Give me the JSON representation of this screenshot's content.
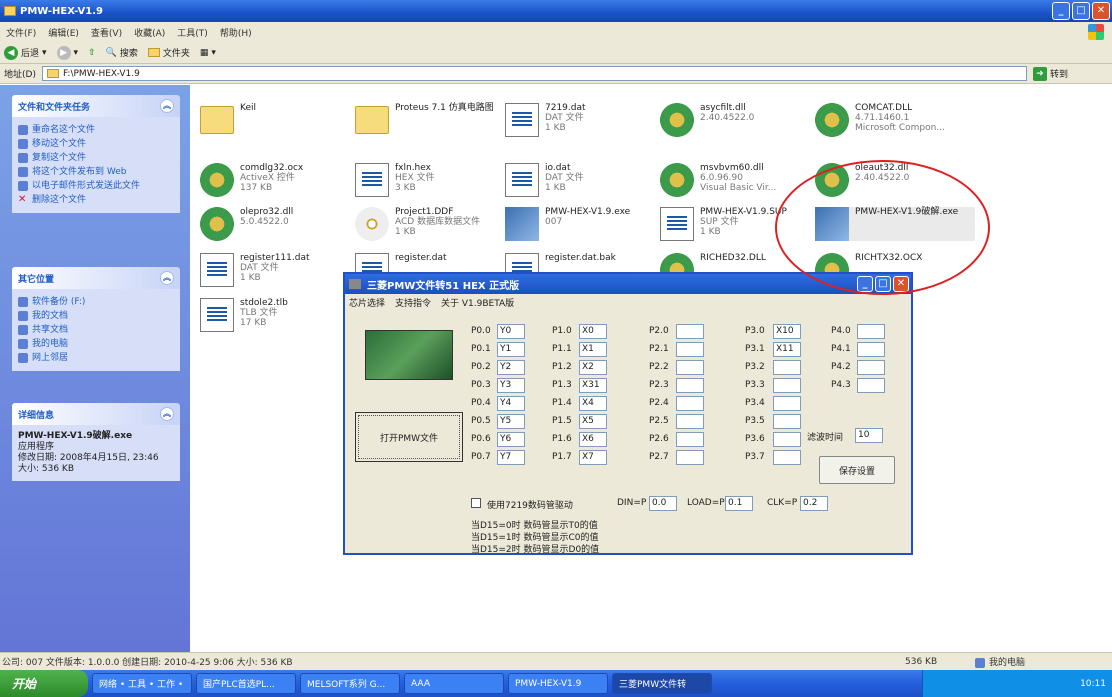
{
  "window": {
    "title": "PMW-HEX-V1.9"
  },
  "menubar": [
    "文件(F)",
    "编辑(E)",
    "查看(V)",
    "收藏(A)",
    "工具(T)",
    "帮助(H)"
  ],
  "toolbar": {
    "back": "后退",
    "search": "搜索",
    "folders": "文件夹"
  },
  "address": {
    "label": "地址(D)",
    "value": "F:\\PMW-HEX-V1.9",
    "go": "转到"
  },
  "tasks": {
    "header": "文件和文件夹任务",
    "items": [
      "重命名这个文件",
      "移动这个文件",
      "复制这个文件",
      "将这个文件发布到 Web",
      "以电子邮件形式发送此文件",
      "删除这个文件"
    ]
  },
  "places": {
    "header": "其它位置",
    "items": [
      "软件备份 (F:)",
      "我的文档",
      "共享文档",
      "我的电脑",
      "网上邻居"
    ]
  },
  "details": {
    "header": "详细信息",
    "name": "PMW-HEX-V1.9破解.exe",
    "type": "应用程序",
    "modified": "修改日期: 2008年4月15日, 23:46",
    "size": "大小: 536 KB"
  },
  "files": [
    {
      "name": "Keil",
      "sub1": "",
      "sub2": "",
      "icon": "folder-icon"
    },
    {
      "name": "Proteus 7.1 仿真电路图",
      "sub1": "",
      "sub2": "",
      "icon": "folder-icon"
    },
    {
      "name": "7219.dat",
      "sub1": "DAT 文件",
      "sub2": "1 KB",
      "icon": "doc-icon"
    },
    {
      "name": "asycfilt.dll",
      "sub1": "2.40.4522.0",
      "sub2": "",
      "icon": "gear-icon"
    },
    {
      "name": "COMCAT.DLL",
      "sub1": "4.71.1460.1",
      "sub2": "Microsoft Compon...",
      "icon": "gear-icon"
    },
    {
      "name": "comdlg32.ocx",
      "sub1": "ActiveX 控件",
      "sub2": "137 KB",
      "icon": "gear-icon"
    },
    {
      "name": "fxln.hex",
      "sub1": "HEX 文件",
      "sub2": "3 KB",
      "icon": "doc-icon"
    },
    {
      "name": "io.dat",
      "sub1": "DAT 文件",
      "sub2": "1 KB",
      "icon": "doc-icon"
    },
    {
      "name": "msvbvm60.dll",
      "sub1": "6.0.96.90",
      "sub2": "Visual Basic Vir...",
      "icon": "gear-icon"
    },
    {
      "name": "oleaut32.dll",
      "sub1": "2.40.4522.0",
      "sub2": "",
      "icon": "gear-icon"
    },
    {
      "name": "olepro32.dll",
      "sub1": "5.0.4522.0",
      "sub2": "",
      "icon": "gear-icon"
    },
    {
      "name": "Project1.DDF",
      "sub1": "ACD 数据库数据文件",
      "sub2": "1 KB",
      "icon": "cd-icon"
    },
    {
      "name": "PMW-HEX-V1.9.exe",
      "sub1": "007",
      "sub2": "",
      "icon": "app-icon"
    },
    {
      "name": "PMW-HEX-V1.9.SUP",
      "sub1": "SUP 文件",
      "sub2": "1 KB",
      "icon": "doc-icon"
    },
    {
      "name": "PMW-HEX-V1.9破解.exe",
      "sub1": "",
      "sub2": "",
      "icon": "app-icon"
    },
    {
      "name": "register111.dat",
      "sub1": "DAT 文件",
      "sub2": "1 KB",
      "icon": "doc-icon"
    },
    {
      "name": "register.dat",
      "sub1": "",
      "sub2": "",
      "icon": "doc-icon"
    },
    {
      "name": "register.dat.bak",
      "sub1": "",
      "sub2": "",
      "icon": "doc-icon"
    },
    {
      "name": "RICHED32.DLL",
      "sub1": "",
      "sub2": "",
      "icon": "gear-icon"
    },
    {
      "name": "RICHTX32.OCX",
      "sub1": "",
      "sub2": "",
      "icon": "gear-icon"
    },
    {
      "name": "stdole2.tlb",
      "sub1": "TLB 文件",
      "sub2": "17 KB",
      "icon": "doc-icon"
    }
  ],
  "dialog": {
    "title": "三菱PMW文件转51 HEX     正式版",
    "menu": [
      "芯片选择",
      "支持指令",
      "关于 V1.9BETA版"
    ],
    "open_button": "打开PMW文件",
    "save_button": "保存设置",
    "filter_label": "滤波时间",
    "filter_value": "10",
    "p0_labels": [
      "P0.0",
      "P0.1",
      "P0.2",
      "P0.3",
      "P0.4",
      "P0.5",
      "P0.6",
      "P0.7"
    ],
    "p0_values": [
      "Y0",
      "Y1",
      "Y2",
      "Y3",
      "Y4",
      "Y5",
      "Y6",
      "Y7"
    ],
    "p1_labels": [
      "P1.0",
      "P1.1",
      "P1.2",
      "P1.3",
      "P1.4",
      "P1.5",
      "P1.6",
      "P1.7"
    ],
    "p1_values": [
      "X0",
      "X1",
      "X2",
      "X31",
      "X4",
      "X5",
      "X6",
      "X7"
    ],
    "p2_labels": [
      "P2.0",
      "P2.1",
      "P2.2",
      "P2.3",
      "P2.4",
      "P2.5",
      "P2.6",
      "P2.7"
    ],
    "p2_values": [
      "",
      "",
      "",
      "",
      "",
      "",
      "",
      ""
    ],
    "p3_labels": [
      "P3.0",
      "P3.1",
      "P3.2",
      "P3.3",
      "P3.4",
      "P3.5",
      "P3.6",
      "P3.7"
    ],
    "p3_values": [
      "X10",
      "X11",
      "",
      "",
      "",
      "",
      "",
      ""
    ],
    "p4_labels": [
      "P4.0",
      "P4.1",
      "P4.2",
      "P4.3"
    ],
    "p4_values": [
      "",
      "",
      "",
      ""
    ],
    "checkbox_label": "使用7219数码管驱动",
    "din_label": "DIN=P",
    "din_value": "0.0",
    "load_label": "LOAD=P",
    "load_value": "0.1",
    "clk_label": "CLK=P",
    "clk_value": "0.2",
    "notes": [
      "当D15=0时 数码管显示T0的值",
      "当D15=1时 数码管显示C0的值",
      "当D15=2时 数码管显示D0的值"
    ]
  },
  "statusbar": {
    "text": "公司: 007 文件版本: 1.0.0.0 创建日期: 2010-4-25 9:06 大小: 536 KB",
    "size": "536 KB",
    "location": "我的电脑"
  },
  "taskbar": {
    "start": "开始",
    "items": [
      "网络 • 工具 • 工作 •",
      "国产PLC首选PL...",
      "MELSOFT系列 G...",
      "AAA",
      "PMW-HEX-V1.9",
      "三菱PMW文件转"
    ],
    "clock": "10:11"
  }
}
